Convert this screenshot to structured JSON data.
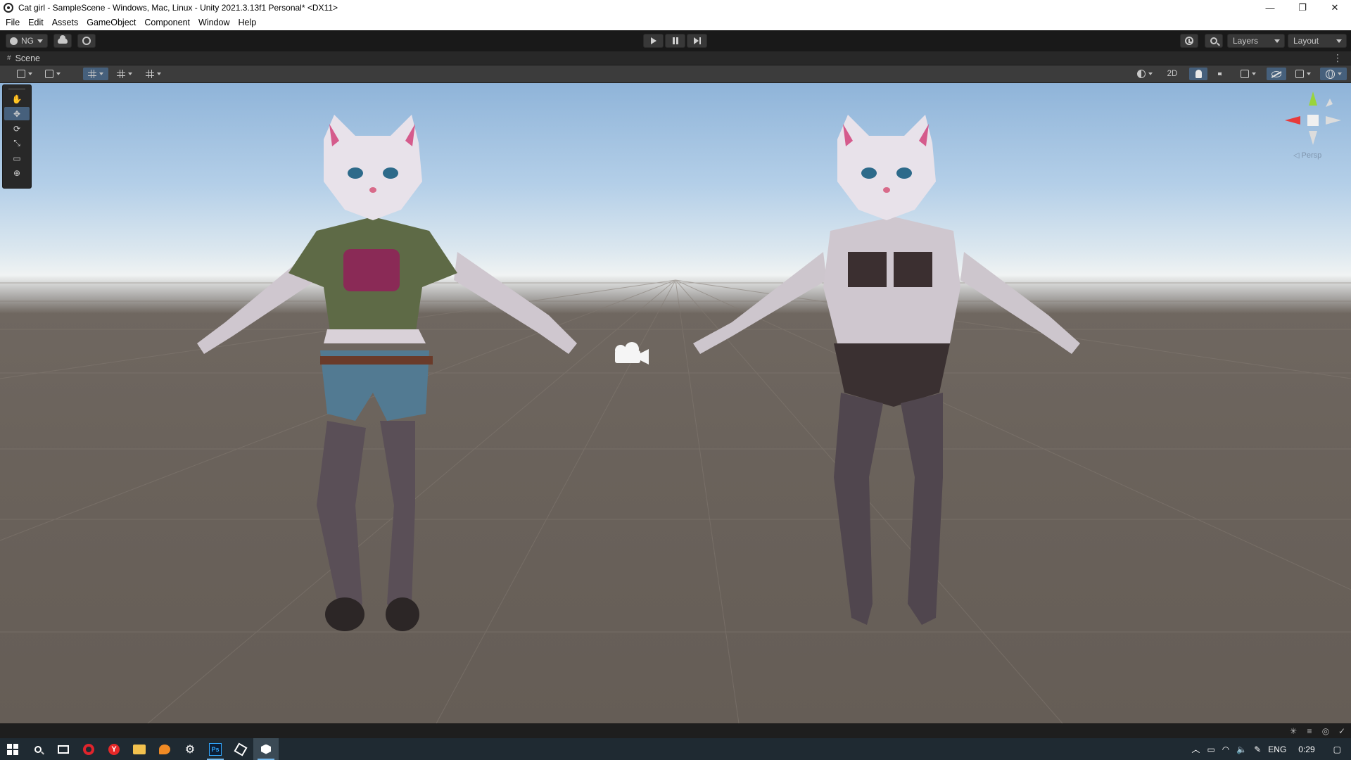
{
  "window": {
    "title": "Cat girl - SampleScene - Windows, Mac, Linux - Unity 2021.3.13f1 Personal* <DX11>",
    "controls": {
      "minimize": "—",
      "restore": "❐",
      "close": "✕"
    }
  },
  "menu": [
    "File",
    "Edit",
    "Assets",
    "GameObject",
    "Component",
    "Window",
    "Help"
  ],
  "toolbar": {
    "account_label": "NG",
    "layers_label": "Layers",
    "layout_label": "Layout"
  },
  "scene": {
    "tab_label": "Scene",
    "mode_2d_label": "2D",
    "persp_label": "◁ Persp",
    "kebab": "⋮"
  },
  "tools": [
    {
      "name": "hand-tool",
      "glyph": "✋",
      "active": false
    },
    {
      "name": "move-tool",
      "glyph": "✥",
      "active": true
    },
    {
      "name": "rotate-tool",
      "glyph": "⟳",
      "active": false
    },
    {
      "name": "scale-tool",
      "glyph": "⤡",
      "active": false
    },
    {
      "name": "rect-tool",
      "glyph": "▭",
      "active": false
    },
    {
      "name": "transform-tool",
      "glyph": "⊕",
      "active": false
    }
  ],
  "gizmo_colors": {
    "x": "#e83a3a",
    "y": "#9ad43a",
    "z": "#3a7ae8",
    "neutral": "#dcdcdc"
  },
  "characters": [
    {
      "name": "Cat girl (clothed)",
      "outfit": "plaid shirt, denim shorts, stockings, boots"
    },
    {
      "name": "Cat girl (base mesh)",
      "outfit": "underwear, stockings"
    }
  ],
  "taskbar": {
    "icons": [
      "windows-start-icon",
      "search-icon",
      "task-view-icon",
      "opera-icon",
      "yandex-browser-icon",
      "file-explorer-icon",
      "blender-icon",
      "settings-icon",
      "photoshop-icon",
      "unity-hub-icon",
      "unity-editor-icon"
    ],
    "ps_label": "Ps",
    "language": "ENG",
    "time": "0:29"
  },
  "colors": {
    "accent_blue": "#46607c",
    "sky_top": "#8fb4d9",
    "ground": "#6a625b",
    "taskbar": "#1f2a32"
  }
}
